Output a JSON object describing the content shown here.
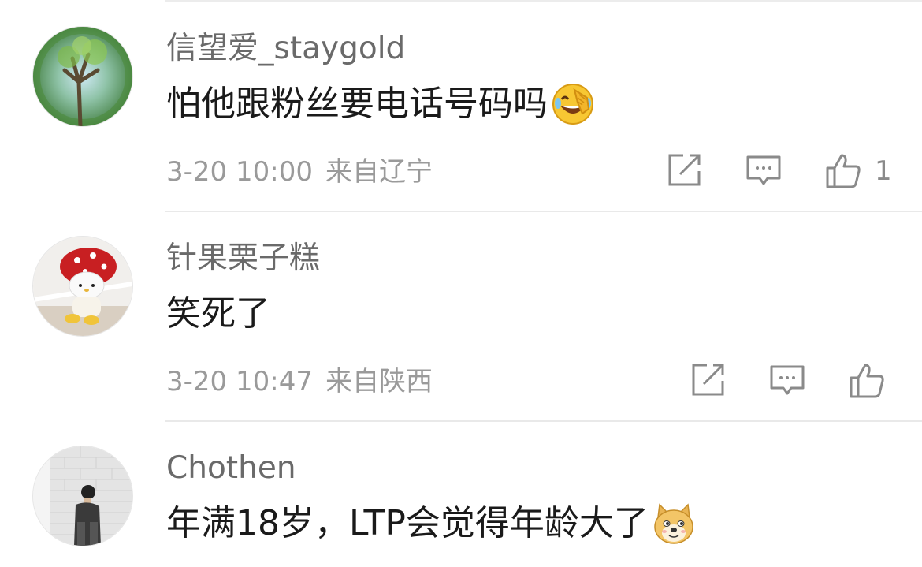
{
  "comments": [
    {
      "username": "信望爱_staygold",
      "text": "怕他跟粉丝要电话号码吗",
      "emoji": "laugh-cry-emoji",
      "date": "3-20 10:00",
      "location": "来自辽宁",
      "likes": "1"
    },
    {
      "username": "针果栗子糕",
      "text": "笑死了",
      "date": "3-20 10:47",
      "location": "来自陕西",
      "likes": ""
    },
    {
      "username": "Chothen",
      "text": "年满18岁，LTP会觉得年龄大了",
      "emoji": "doge-emoji"
    }
  ],
  "icons": {
    "share": "share-icon",
    "reply": "comment-icon",
    "like": "thumbs-up-icon"
  },
  "colors": {
    "username": "#6a6a6a",
    "text": "#1a1a1a",
    "meta": "#9a9a9a",
    "divider": "#e9e9e9"
  }
}
